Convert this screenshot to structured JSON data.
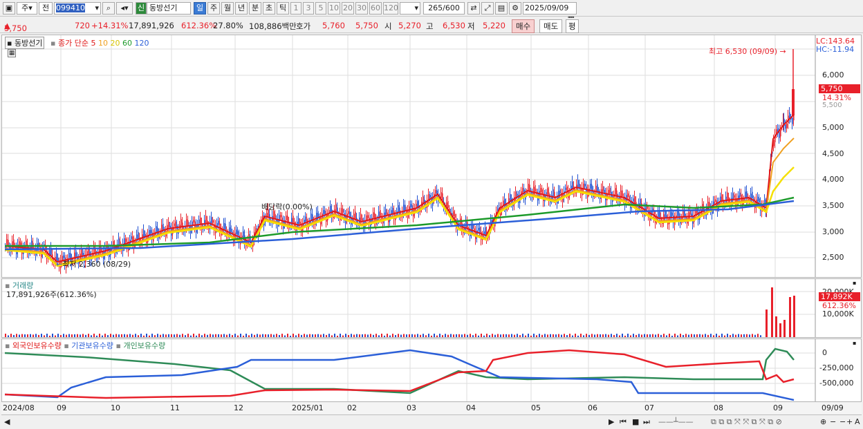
{
  "toolbar": {
    "market_label": "주",
    "type_label": "전",
    "code": "099410",
    "new_badge": "신",
    "stock_name": "동방선기",
    "periods": [
      "일",
      "주",
      "월",
      "년",
      "분",
      "초",
      "틱"
    ],
    "intervals": [
      "1",
      "3",
      "5",
      "10",
      "20",
      "30",
      "60",
      "120"
    ],
    "count": "265",
    "count_total": "/600",
    "date": "2025/09/09"
  },
  "quote": {
    "price": "5,750",
    "change": "720",
    "change_pct": "+14.31%",
    "volume": "17,891,926",
    "vol_ratio": "612.36%",
    "turnover": "27.80%",
    "amount": "108,886백만",
    "bid_label": "호가",
    "ask": "5,760",
    "bid": "5,750",
    "open_label": "시",
    "open": "5,270",
    "high_label": "고",
    "high": "6,530",
    "low_label": "저",
    "low": "5,220",
    "buy_btn": "매수",
    "sell_btn": "매도",
    "eval_btn": "평"
  },
  "price_panel": {
    "series_tag": "동방선기",
    "ma_label": "종가 단순",
    "ma_periods": [
      "5",
      "10",
      "20",
      "60",
      "120"
    ],
    "lc": "LC:143.64",
    "hc": "HC:-11.94",
    "high_note": "최고 6,530 (09/09)",
    "low_note": "최저 2,360 (08/29)",
    "dividend_note": "배당락(0.00%)",
    "last_price_tag": "5,750",
    "last_pct_tag": "14.31%",
    "y_ticks": [
      "6,000",
      "5,500",
      "5,000",
      "4,500",
      "4,000",
      "3,500",
      "3,000",
      "2,500"
    ]
  },
  "volume_panel": {
    "title": "거래량",
    "value": "17,891,926주(612.36%)",
    "y_ticks": [
      "20,000K",
      "10,000K"
    ],
    "tag_value": "17,892K",
    "tag_pct": "612.36%"
  },
  "holding_panel": {
    "legend": [
      "외국인보유수량",
      "기관보유수량",
      "개인보유수량"
    ],
    "y_ticks": [
      "0",
      "-250,000",
      "-500,000"
    ]
  },
  "x_axis": {
    "labels": [
      "2024/08",
      "09",
      "10",
      "11",
      "12",
      "2025/01",
      "02",
      "03",
      "04",
      "05",
      "06",
      "07",
      "08",
      "09",
      "09/09"
    ]
  },
  "colors": {
    "up": "#e8202a",
    "down": "#1f4fd1",
    "ma5": "#e01818",
    "ma10": "#f0a020",
    "ma20": "#f5e000",
    "ma60": "#1c9a2a",
    "ma120": "#2b5fd8"
  }
}
